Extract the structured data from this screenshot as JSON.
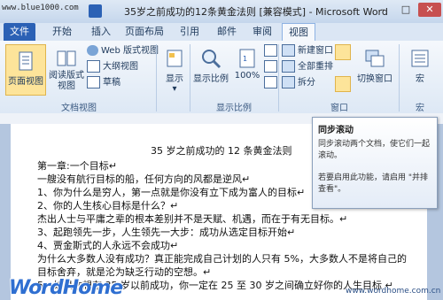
{
  "window": {
    "watermark_url": "www.blue1000.com",
    "title": "35岁之前成功的12条黄金法则 [兼容模式] - Microsoft Word",
    "minimize": "–",
    "maximize": "□",
    "close": "✕"
  },
  "tabs": [
    {
      "label": "文件"
    },
    {
      "label": "开始"
    },
    {
      "label": "插入"
    },
    {
      "label": "页面布局"
    },
    {
      "label": "引用"
    },
    {
      "label": "邮件"
    },
    {
      "label": "审阅"
    },
    {
      "label": "视图"
    }
  ],
  "ribbon": {
    "views": {
      "print_layout": "页面视图",
      "read_mode": "阅读版式\n视图",
      "web_layout": "Web 版式视图",
      "outline": "大纲视图",
      "draft": "草稿",
      "group_label": "文档视图"
    },
    "show": {
      "label": "显示",
      "arrow": "▾"
    },
    "zoom": {
      "zoom": "显示比例",
      "percent": "100%",
      "group_label": "显示比例"
    },
    "window": {
      "new_window": "新建窗口",
      "arrange_all": "全部重排",
      "split": "拆分",
      "switch_windows": "切换窗口",
      "group_label": "窗口"
    },
    "macros": {
      "label": "宏",
      "group_label": "宏"
    }
  },
  "tooltip": {
    "title": "同步滚动",
    "body": "同步滚动两个文档，使它们一起滚动。",
    "body2": "若要启用此功能，请启用 \"并排查看\"。"
  },
  "document": {
    "title": "35 岁之前成功的 12 条黄金法则",
    "lines": [
      "第一章:一个目标↵",
      "一艘没有航行目标的船，任何方向的风都是逆风↵",
      "1、你为什么是穷人，第一点就是你没有立下成为富人的目标↵",
      "2、你的人生核心目标是什么？↵",
      "杰出人士与平庸之辈的根本差别并不是天赋、机遇，而在于有无目标。↵",
      "3、起跑领先一步，人生领先一大步：成功从选定目标开始↵",
      "4、贾金斯式的人永远不会成功↵",
      "为什么大多数人没有成功？真正能完成自己计划的人只有 5%，大多数人不是将自己的",
      "目标舍弃，就是沦为缺乏行动的空想。↵",
      "5、如果你想在 35 岁以前成功，你一定在 25 至 30 岁之间确立好你的人生目标 ↵"
    ]
  },
  "branding": {
    "logo": "WordHome",
    "corner": "www.wordhome.com.cn"
  }
}
